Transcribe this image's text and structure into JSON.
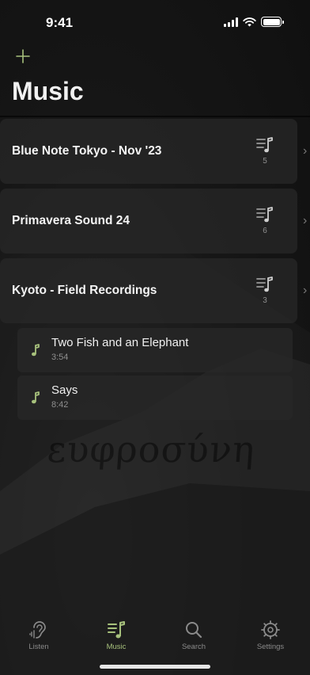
{
  "status_bar": {
    "time": "9:41"
  },
  "header": {
    "add_icon": "plus-icon",
    "title": "Music"
  },
  "playlists": [
    {
      "name": "Blue Note Tokyo - Nov '23",
      "count": "5"
    },
    {
      "name": "Primavera Sound 24",
      "count": "6"
    },
    {
      "name": "Kyoto - Field Recordings",
      "count": "3"
    }
  ],
  "tracks": [
    {
      "title": "Two Fish and an Elephant",
      "duration": "3:54"
    },
    {
      "title": "Says",
      "duration": "8:42"
    }
  ],
  "background_text": {
    "line1": "ευφροσύνη"
  },
  "tab_bar": {
    "tabs": [
      {
        "label": "Listen",
        "icon": "ear-icon"
      },
      {
        "label": "Music",
        "icon": "music-list-icon"
      },
      {
        "label": "Search",
        "icon": "search-icon"
      },
      {
        "label": "Settings",
        "icon": "gear-icon"
      }
    ],
    "active": "Music"
  },
  "colors": {
    "accent": "#a7c17c",
    "card": "#282828",
    "background": "#141414",
    "muted": "#8f8f8f"
  }
}
